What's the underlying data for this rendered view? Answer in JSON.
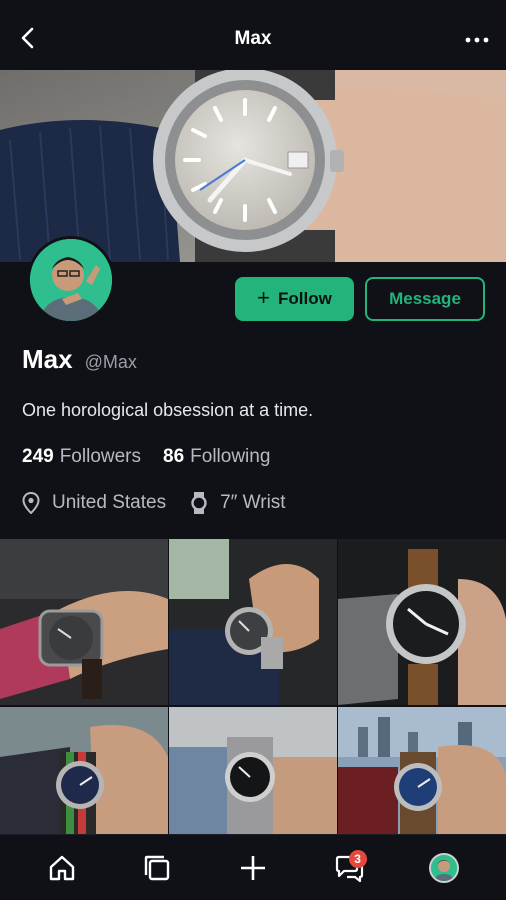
{
  "header": {
    "title": "Max",
    "back_icon": "chevron-left-icon",
    "more_icon": "more-horizontal-icon"
  },
  "profile": {
    "display_name": "Max",
    "handle": "@Max",
    "bio": "One horological obsession at a time.",
    "followers_count": "249",
    "followers_label": "Followers",
    "following_count": "86",
    "following_label": "Following",
    "location": "United States",
    "wrist": "7″ Wrist"
  },
  "actions": {
    "follow_label": "Follow",
    "message_label": "Message"
  },
  "colors": {
    "accent": "#22b47b",
    "background": "#0f1117",
    "badge": "#e5483d"
  },
  "nav": {
    "items": [
      {
        "icon": "home-icon"
      },
      {
        "icon": "collection-icon"
      },
      {
        "icon": "plus-icon"
      },
      {
        "icon": "messages-icon",
        "badge": "3"
      },
      {
        "icon": "profile-avatar-icon"
      }
    ]
  }
}
